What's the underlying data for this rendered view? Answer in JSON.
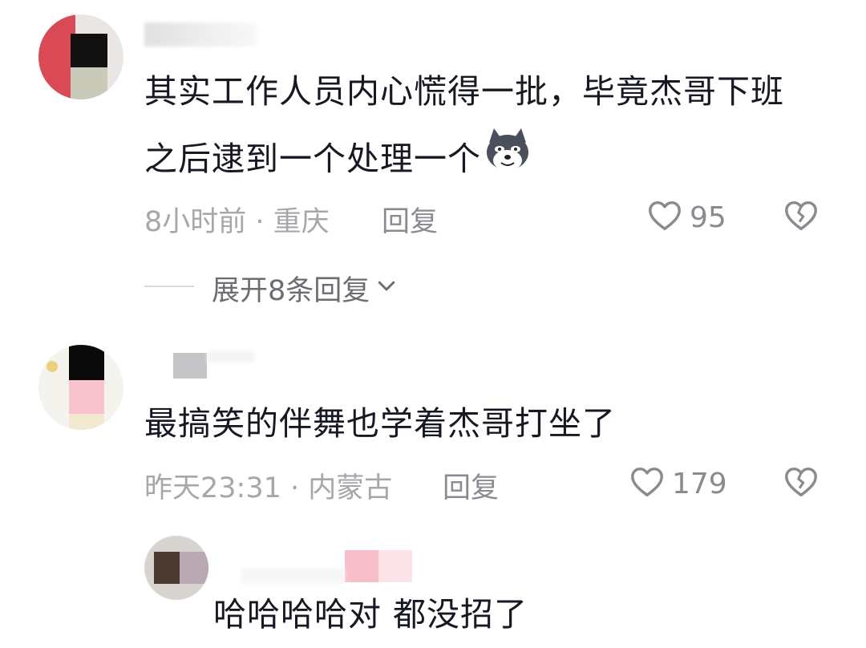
{
  "comments": [
    {
      "text": "其实工作人员内心慌得一批，毕竟杰哥下班之后逮到一个处理一个",
      "emoji_icon": "wolf-smirk-emoji",
      "time": "8小时前",
      "location": "重庆",
      "reply_label": "回复",
      "likes": "95",
      "expand_label": "展开8条回复"
    },
    {
      "text": "最搞笑的伴舞也学着杰哥打坐了",
      "time": "昨天23:31",
      "location": "内蒙古",
      "reply_label": "回复",
      "likes": "179"
    }
  ],
  "reply": {
    "text": "哈哈哈哈对 都没招了"
  },
  "colors": {
    "text": "#161823",
    "meta": "#a6a7ab",
    "action": "#8a8b91"
  }
}
